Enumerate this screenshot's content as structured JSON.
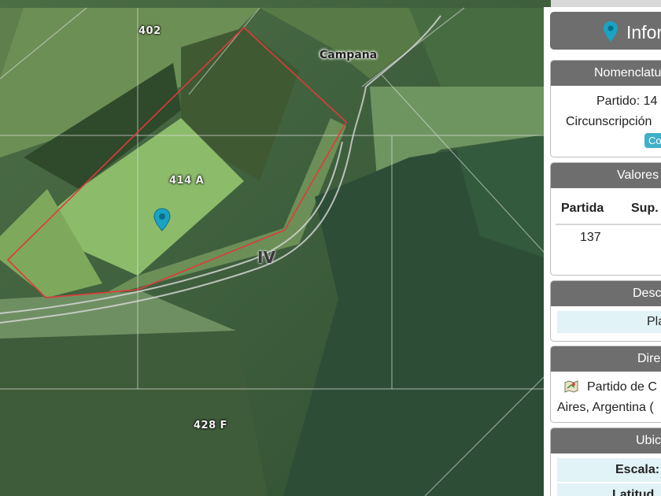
{
  "map": {
    "labels": {
      "parcel_402": "402",
      "parcel_414a": "414 A",
      "parcel_428f": "428 F",
      "town": "Campana",
      "zone": "IV"
    },
    "colors": {
      "boundary": "#e03a3a",
      "pin": "#1aa3c4",
      "lines": "#e6e6e6"
    }
  },
  "panel": {
    "title": "Infor",
    "title_icon": "map-marker-icon",
    "nomenclatura": {
      "header": "Nomenclatu",
      "partido": "Partido: 14",
      "circunscripcion": "Circunscripción",
      "badge": "Co"
    },
    "valores": {
      "header": "Valores",
      "col_partida": "Partida",
      "col_sup": "Sup.",
      "partida_value": "137"
    },
    "descripcion": {
      "header": "Desc",
      "value": "Pla"
    },
    "direccion": {
      "header": "Dire",
      "line1": "Partido de C",
      "line2": "Aires, Argentina (",
      "icon": "map-icon"
    },
    "ubicacion": {
      "header": "Ubic",
      "escala": "Escala:",
      "latitud": "Latitud"
    }
  }
}
